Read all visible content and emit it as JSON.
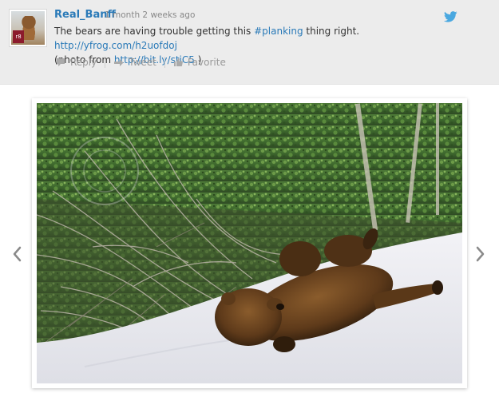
{
  "tweet": {
    "username": "Real_Banff",
    "timestamp": "1 month 2 weeks ago",
    "avatar_badge": "r8",
    "text_part1": "The bears are having trouble getting this ",
    "hashtag": "#planking",
    "text_part2": " thing right. ",
    "link1": "http://yfrog.com/h2uofdoj",
    "text_part3": "(photo from ",
    "link2": "http://bit.ly/stiC5",
    "text_part4": " )",
    "actions": {
      "reply": "Reply",
      "retweet": "Tweet",
      "favorite": "Favorite"
    },
    "service_icon": "twitter-bird-icon"
  },
  "gallery": {
    "prev_icon": "chevron-left-icon",
    "next_icon": "chevron-right-icon",
    "photo_subject": "grizzly-bear-sliding-on-snow"
  },
  "colors": {
    "link": "#2a7ab8",
    "card_bg": "#ececec",
    "twitter_blue": "#4aa8e0"
  }
}
